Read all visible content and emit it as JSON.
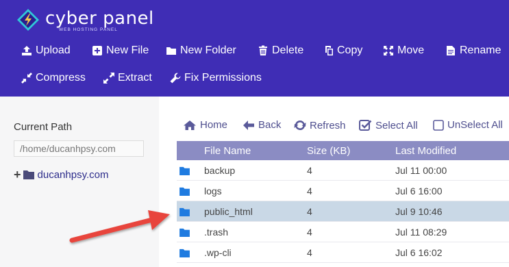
{
  "brand": {
    "title": "cyber panel",
    "subtitle": "WEB HOSTING PANEL"
  },
  "toolbar": {
    "upload": "Upload",
    "new_file": "New File",
    "new_folder": "New Folder",
    "delete": "Delete",
    "copy": "Copy",
    "move": "Move",
    "rename": "Rename",
    "compress": "Compress",
    "extract": "Extract",
    "fix_permissions": "Fix Permissions"
  },
  "sidebar": {
    "current_path_label": "Current Path",
    "current_path_value": "/home/ducanhpsy.com",
    "tree_root": "ducanhpsy.com"
  },
  "actions": {
    "home": "Home",
    "back": "Back",
    "refresh": "Refresh",
    "select_all": "Select All",
    "unselect_all": "UnSelect All"
  },
  "table": {
    "headers": [
      "File Name",
      "Size (KB)",
      "Last Modified"
    ],
    "rows": [
      {
        "name": "backup",
        "size": "4",
        "modified": "Jul 11 00:00"
      },
      {
        "name": "logs",
        "size": "4",
        "modified": "Jul 6 16:00"
      },
      {
        "name": "public_html",
        "size": "4",
        "modified": "Jul 9 10:46"
      },
      {
        "name": ".trash",
        "size": "4",
        "modified": "Jul 11 08:29"
      },
      {
        "name": ".wp-cli",
        "size": "4",
        "modified": "Jul 6 16:02"
      }
    ],
    "selected_row": "public_html"
  },
  "colors": {
    "header_bg": "#3f2db5",
    "table_header_bg": "#8b8cc3",
    "selected_row_bg": "#c9d8e6",
    "folder_icon": "#1f7be0",
    "arrow": "#e8453c"
  },
  "icons": [
    "cyberpanel-logo-icon",
    "upload-icon",
    "plus-square-icon",
    "folder-icon",
    "trash-icon",
    "copy-icon",
    "move-icon",
    "file-text-icon",
    "compress-icon",
    "expand-icon",
    "wrench-icon",
    "home-icon",
    "back-arrow-icon",
    "refresh-icon",
    "check-square-icon",
    "square-icon",
    "folder-icon"
  ]
}
